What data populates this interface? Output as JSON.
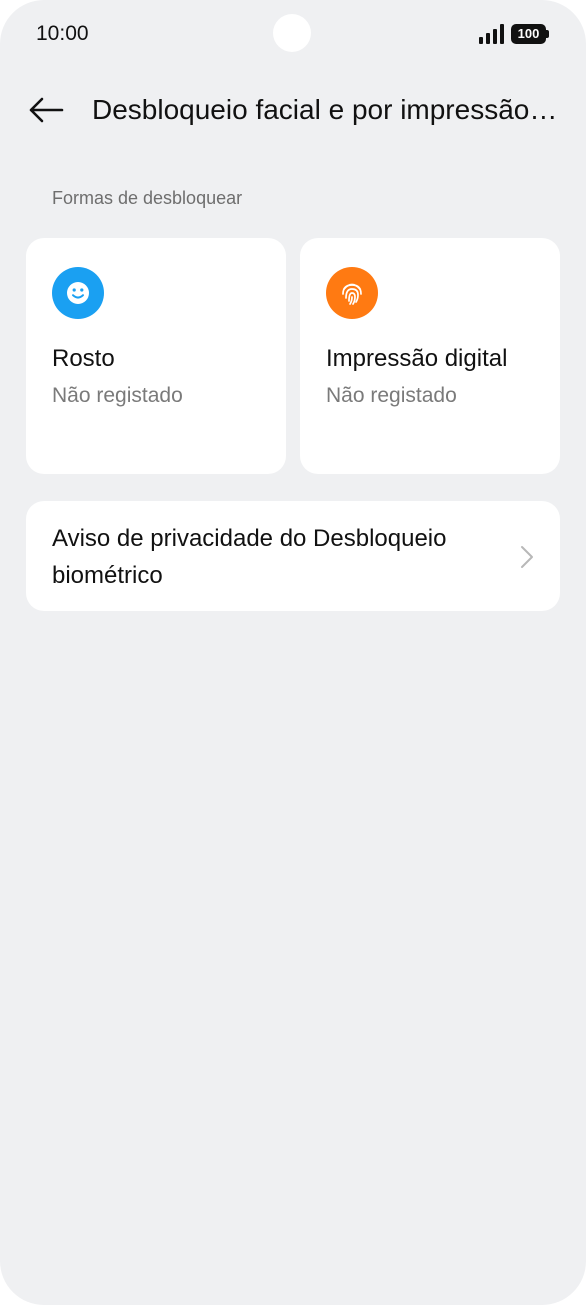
{
  "status_bar": {
    "time": "10:00",
    "battery": "100",
    "icons": [
      "signal-icon",
      "battery-icon"
    ]
  },
  "header": {
    "back_icon": "arrow-left-icon",
    "title": "Desbloqueio facial e por impressão digital"
  },
  "section": {
    "label": "Formas de desbloquear"
  },
  "methods": [
    {
      "icon": "face-icon",
      "icon_color": "#1aa0f2",
      "title": "Rosto",
      "status": "Não registado"
    },
    {
      "icon": "fingerprint-icon",
      "icon_color": "#ff7a12",
      "title": "Impressão digital",
      "status": "Não registado"
    }
  ],
  "privacy": {
    "label": "Aviso de privacidade do Desbloqueio biométrico",
    "icon": "chevron-right-icon"
  }
}
